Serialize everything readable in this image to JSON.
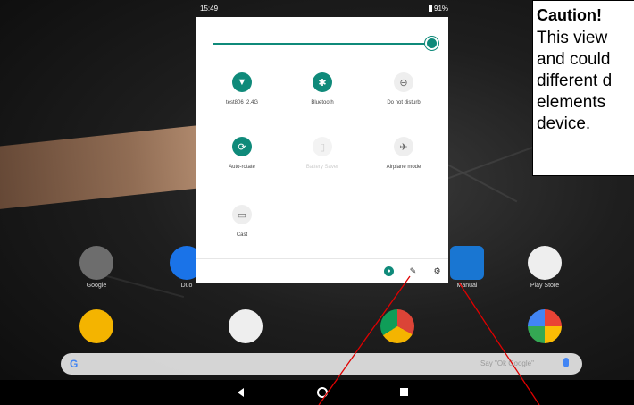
{
  "status_bar": {
    "time": "15:49",
    "battery": "91%"
  },
  "quick_settings": {
    "tiles": [
      {
        "label": "test806_2.4G",
        "icon": "wifi-icon",
        "state": "on",
        "glyph": "▼"
      },
      {
        "label": "Bluetooth",
        "icon": "bluetooth-icon",
        "state": "on",
        "glyph": "✱"
      },
      {
        "label": "Do not disturb",
        "icon": "do-not-disturb-icon",
        "state": "off",
        "glyph": "⊖"
      },
      {
        "label": "Auto-rotate",
        "icon": "auto-rotate-icon",
        "state": "on",
        "glyph": "⟳"
      },
      {
        "label": "Battery Saver",
        "icon": "battery-saver-icon",
        "state": "disabled",
        "glyph": "▯"
      },
      {
        "label": "Airplane mode",
        "icon": "airplane-icon",
        "state": "off",
        "glyph": "✈"
      },
      {
        "label": "Cast",
        "icon": "cast-icon",
        "state": "off",
        "glyph": "▭"
      }
    ],
    "footer_icons": {
      "user": "user-icon",
      "edit": "edit-icon",
      "settings": "settings-icon"
    }
  },
  "home_apps": [
    {
      "label": "Google",
      "icon": "google-folder-icon",
      "color": "#6d6d6d"
    },
    {
      "label": "Duo",
      "icon": "duo-icon",
      "color": "#1a73e8"
    },
    {
      "label": "Manual",
      "icon": "manual-icon",
      "color": "#1976d2"
    },
    {
      "label": "Play Store",
      "icon": "play-store-icon",
      "color": "#eeeeee"
    },
    {
      "label": "",
      "icon": "slides-icon",
      "color": "#f4b400"
    },
    {
      "label": "",
      "icon": "gmail-icon",
      "color": "#eeeeee"
    },
    {
      "label": "",
      "icon": "chrome-icon",
      "color": "#db4437"
    },
    {
      "label": "",
      "icon": "photos-icon",
      "color": "#eeeeee"
    }
  ],
  "search": {
    "hint": "Say \"Ok Google\""
  },
  "caution": {
    "title": "Caution!",
    "lines": [
      "This view",
      "and could",
      "different d",
      "elements",
      "device."
    ]
  },
  "colors": {
    "accent": "#0f8a7a",
    "callout": "#e00000"
  }
}
